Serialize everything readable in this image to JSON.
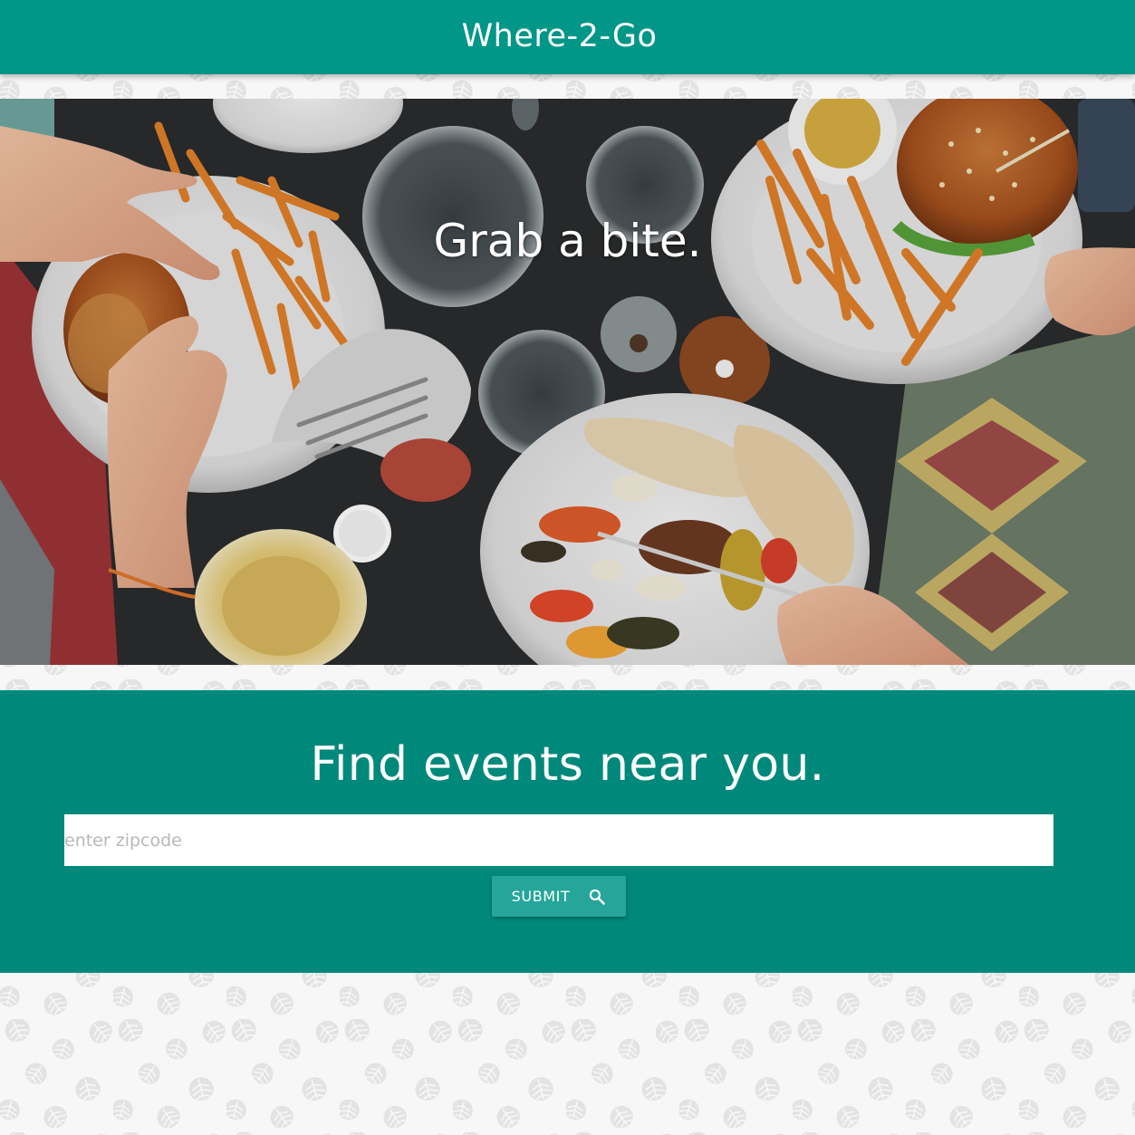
{
  "navbar": {
    "brand": "Where-2-Go"
  },
  "hero": {
    "title": "Grab a bite."
  },
  "search": {
    "heading": "Find events near you.",
    "input_placeholder": "enter zipcode",
    "input_value": "",
    "submit_label": "SUBMIT",
    "submit_icon": "search-icon"
  },
  "colors": {
    "navbar": "#009688",
    "search_section": "#00897b",
    "submit_button": "#26a69a",
    "page_background": "#f7f7f7",
    "pattern_leaf": "#e4e4e4"
  }
}
